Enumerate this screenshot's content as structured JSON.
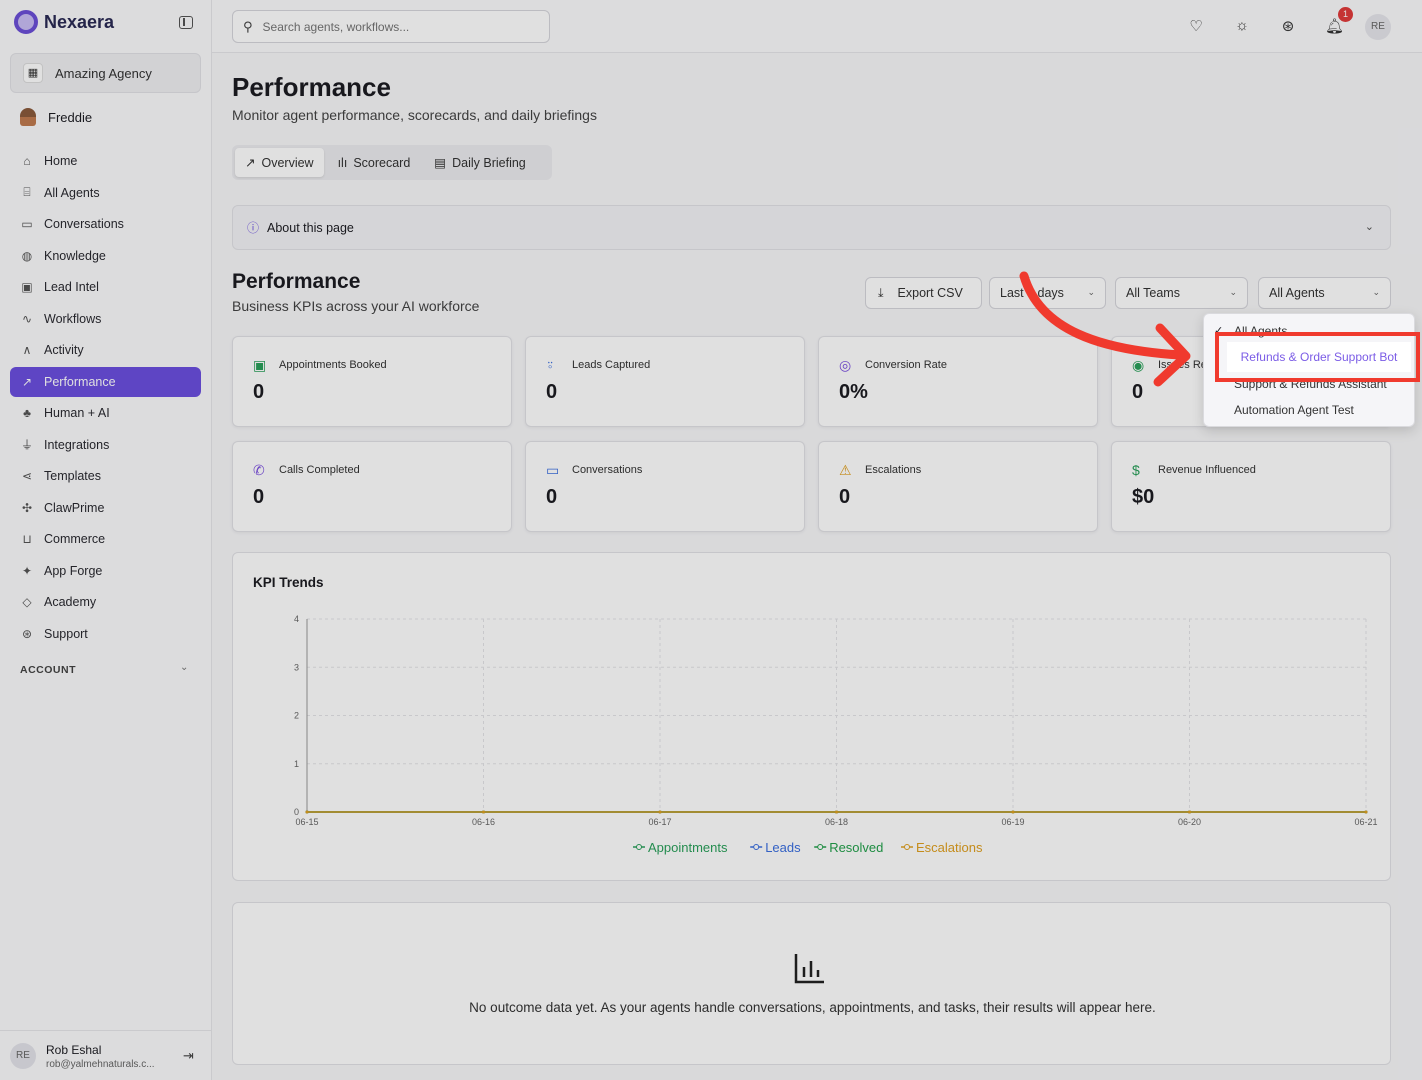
{
  "brand": {
    "name": "Nexaera"
  },
  "workspace": {
    "name": "Amazing Agency"
  },
  "user": {
    "name": "Freddie"
  },
  "nav": [
    {
      "label": "Home",
      "icon": "home-icon"
    },
    {
      "label": "All Agents",
      "icon": "bot-icon"
    },
    {
      "label": "Conversations",
      "icon": "chat-icon"
    },
    {
      "label": "Knowledge",
      "icon": "brain-icon"
    },
    {
      "label": "Lead Intel",
      "icon": "contact-icon"
    },
    {
      "label": "Workflows",
      "icon": "workflow-icon"
    },
    {
      "label": "Activity",
      "icon": "activity-icon"
    },
    {
      "label": "Performance",
      "icon": "trend-icon"
    },
    {
      "label": "Human + AI",
      "icon": "network-icon"
    },
    {
      "label": "Integrations",
      "icon": "plug-icon"
    },
    {
      "label": "Templates",
      "icon": "share-icon"
    },
    {
      "label": "ClawPrime",
      "icon": "paw-icon"
    },
    {
      "label": "Commerce",
      "icon": "cart-icon"
    },
    {
      "label": "App Forge",
      "icon": "sparkle-icon"
    },
    {
      "label": "Academy",
      "icon": "graduation-icon"
    },
    {
      "label": "Support",
      "icon": "lifebuoy-icon"
    }
  ],
  "account_label": "ACCOUNT",
  "footer_user": {
    "initials": "RE",
    "name": "Rob Eshal",
    "email": "rob@yalmehnaturals.c..."
  },
  "search": {
    "placeholder": "Search agents, workflows..."
  },
  "notifications": {
    "count": "1"
  },
  "top_avatar": "RE",
  "page": {
    "title": "Performance",
    "subtitle": "Monitor agent performance, scorecards, and daily briefings"
  },
  "tabs": [
    "Overview",
    "Scorecard",
    "Daily Briefing"
  ],
  "about": "About this page",
  "section": {
    "title": "Performance",
    "subtitle": "Business KPIs across your AI workforce"
  },
  "controls": {
    "export": "Export CSV",
    "range": "Last 7 days",
    "teams": "All Teams",
    "agents": "All Agents"
  },
  "kpis": [
    {
      "label": "Appointments Booked",
      "value": "0",
      "icon": "calendar-check-icon",
      "color": "#2aa05a"
    },
    {
      "label": "Leads Captured",
      "value": "0",
      "icon": "user-plus-icon",
      "color": "#3b6fe0"
    },
    {
      "label": "Conversion Rate",
      "value": "0%",
      "icon": "target-icon",
      "color": "#7b4fe0"
    },
    {
      "label": "Issues Resolved",
      "value": "0",
      "icon": "check-circle-icon",
      "color": "#2aa05a"
    },
    {
      "label": "Calls Completed",
      "value": "0",
      "icon": "phone-icon",
      "color": "#7b4fe0"
    },
    {
      "label": "Conversations",
      "value": "0",
      "icon": "message-icon",
      "color": "#3b6fe0"
    },
    {
      "label": "Escalations",
      "value": "0",
      "icon": "warning-icon",
      "color": "#e0a020"
    },
    {
      "label": "Revenue Influenced",
      "value": "$0",
      "icon": "dollar-icon",
      "color": "#2aa05a"
    }
  ],
  "chart_title": "KPI Trends",
  "chart_data": {
    "type": "line",
    "title": "KPI Trends",
    "x": [
      "06-15",
      "06-16",
      "06-17",
      "06-18",
      "06-19",
      "06-20",
      "06-21"
    ],
    "yticks": [
      "0",
      "1",
      "2",
      "3",
      "4"
    ],
    "ylim": [
      0,
      4
    ],
    "grid": true,
    "legend": "bottom",
    "series": [
      {
        "name": "Appointments",
        "color": "#2aa05a",
        "values": [
          0,
          0,
          0,
          0,
          0,
          0,
          0
        ]
      },
      {
        "name": "Leads",
        "color": "#3b6fe0",
        "values": [
          0,
          0,
          0,
          0,
          0,
          0,
          0
        ]
      },
      {
        "name": "Resolved",
        "color": "#22a04a",
        "values": [
          0,
          0,
          0,
          0,
          0,
          0,
          0
        ]
      },
      {
        "name": "Escalations",
        "color": "#e0a020",
        "values": [
          0,
          0,
          0,
          0,
          0,
          0,
          0
        ]
      }
    ]
  },
  "empty_state": "No outcome data yet. As your agents handle conversations, appointments, and tasks, their results will appear here.",
  "dropdown": {
    "items": [
      "All Agents",
      "Refunds & Order Support Bot",
      "Support & Refunds Assistant",
      "Automation Agent Test"
    ],
    "selected": "All Agents",
    "highlighted": "Refunds & Order Support Bot"
  },
  "colors": {
    "accent": "#6b4fe0",
    "highlight": "#f03a2e"
  }
}
